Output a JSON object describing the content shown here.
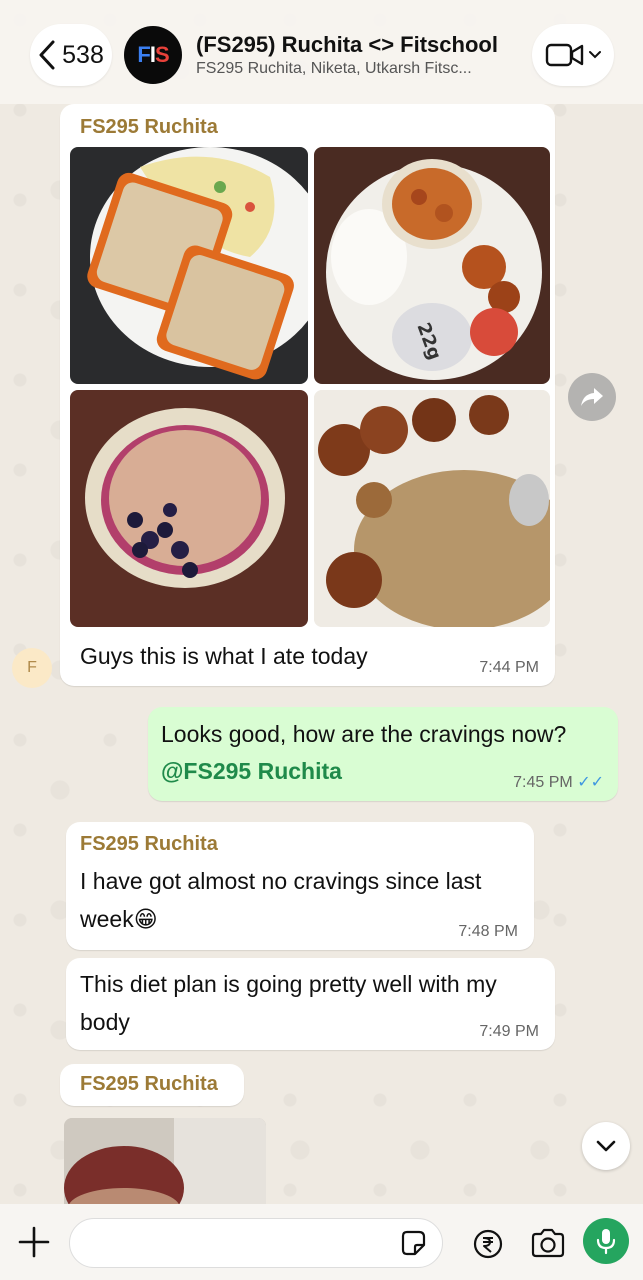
{
  "header": {
    "back_count": "538",
    "avatar_letters": [
      "F",
      "I",
      "S"
    ],
    "title": "(FS295) Ruchita <> Fitschool",
    "subtitle": "FS295 Ruchita, Niketa, Utkarsh Fitsc..."
  },
  "messages": [
    {
      "sender": "FS295 Ruchita",
      "photos": [
        "bread-omelette",
        "rice-paneer-protein-cup",
        "smoothie-bowl-blueberries",
        "chilli-chicken-fried-rice"
      ],
      "text": "Guys this is what I ate today",
      "time": "7:44 PM",
      "avatar_letter": "F"
    },
    {
      "text": "Looks good, how are the cravings now?",
      "mention": "@FS295 Ruchita",
      "time": "7:45 PM"
    },
    {
      "sender": "FS295 Ruchita",
      "text": "I have got almost no cravings since last week😁",
      "time": "7:48 PM"
    },
    {
      "text": "This diet plan is going pretty well with my body",
      "time": "7:49 PM"
    },
    {
      "sender": "FS295 Ruchita",
      "photos": [
        "person-photo"
      ]
    }
  ],
  "composer": {
    "value": "",
    "placeholder": ""
  },
  "icons": {
    "back": "chevron-left-icon",
    "video": "video-camera-icon",
    "forward": "forward-icon",
    "scroll": "chevron-down-icon",
    "plus": "plus-icon",
    "sticker": "sticker-icon",
    "rupee": "rupee-icon",
    "camera": "camera-icon",
    "mic": "microphone-icon"
  },
  "colors": {
    "accent_green": "#25a55f",
    "outgoing_bubble": "#d9fdd3",
    "sender_name": "#9c7a36",
    "read_ticks": "#3f97e0"
  }
}
